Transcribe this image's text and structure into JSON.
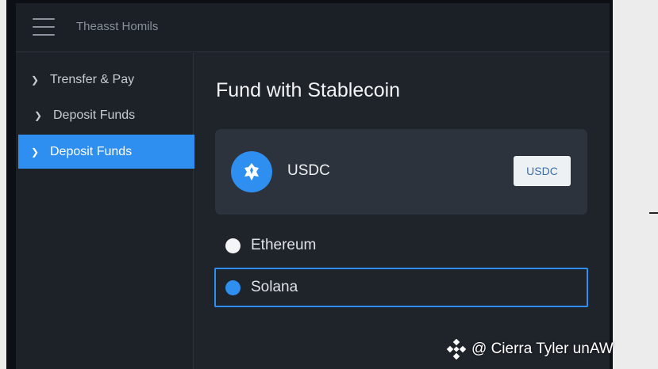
{
  "app": {
    "title": "Theasst Homils"
  },
  "sidebar": {
    "items": [
      {
        "label": "Trensfer & Pay",
        "active": false
      },
      {
        "label": "Deposit Funds",
        "active": false
      },
      {
        "label": "Deposit Funds",
        "active": true
      }
    ]
  },
  "main": {
    "title": "Fund with Stablecoin",
    "token": {
      "name": "USDC",
      "badge": "USDC",
      "icon": "usdc-coin-icon"
    },
    "networks": [
      {
        "label": "Ethereum",
        "selected": false
      },
      {
        "label": "Solana",
        "selected": true
      }
    ]
  },
  "watermark": {
    "text": "@ Cierra Tyler unAW"
  },
  "colors": {
    "accent": "#2f8ff0",
    "background": "#1e232a",
    "card": "#2d333c"
  }
}
